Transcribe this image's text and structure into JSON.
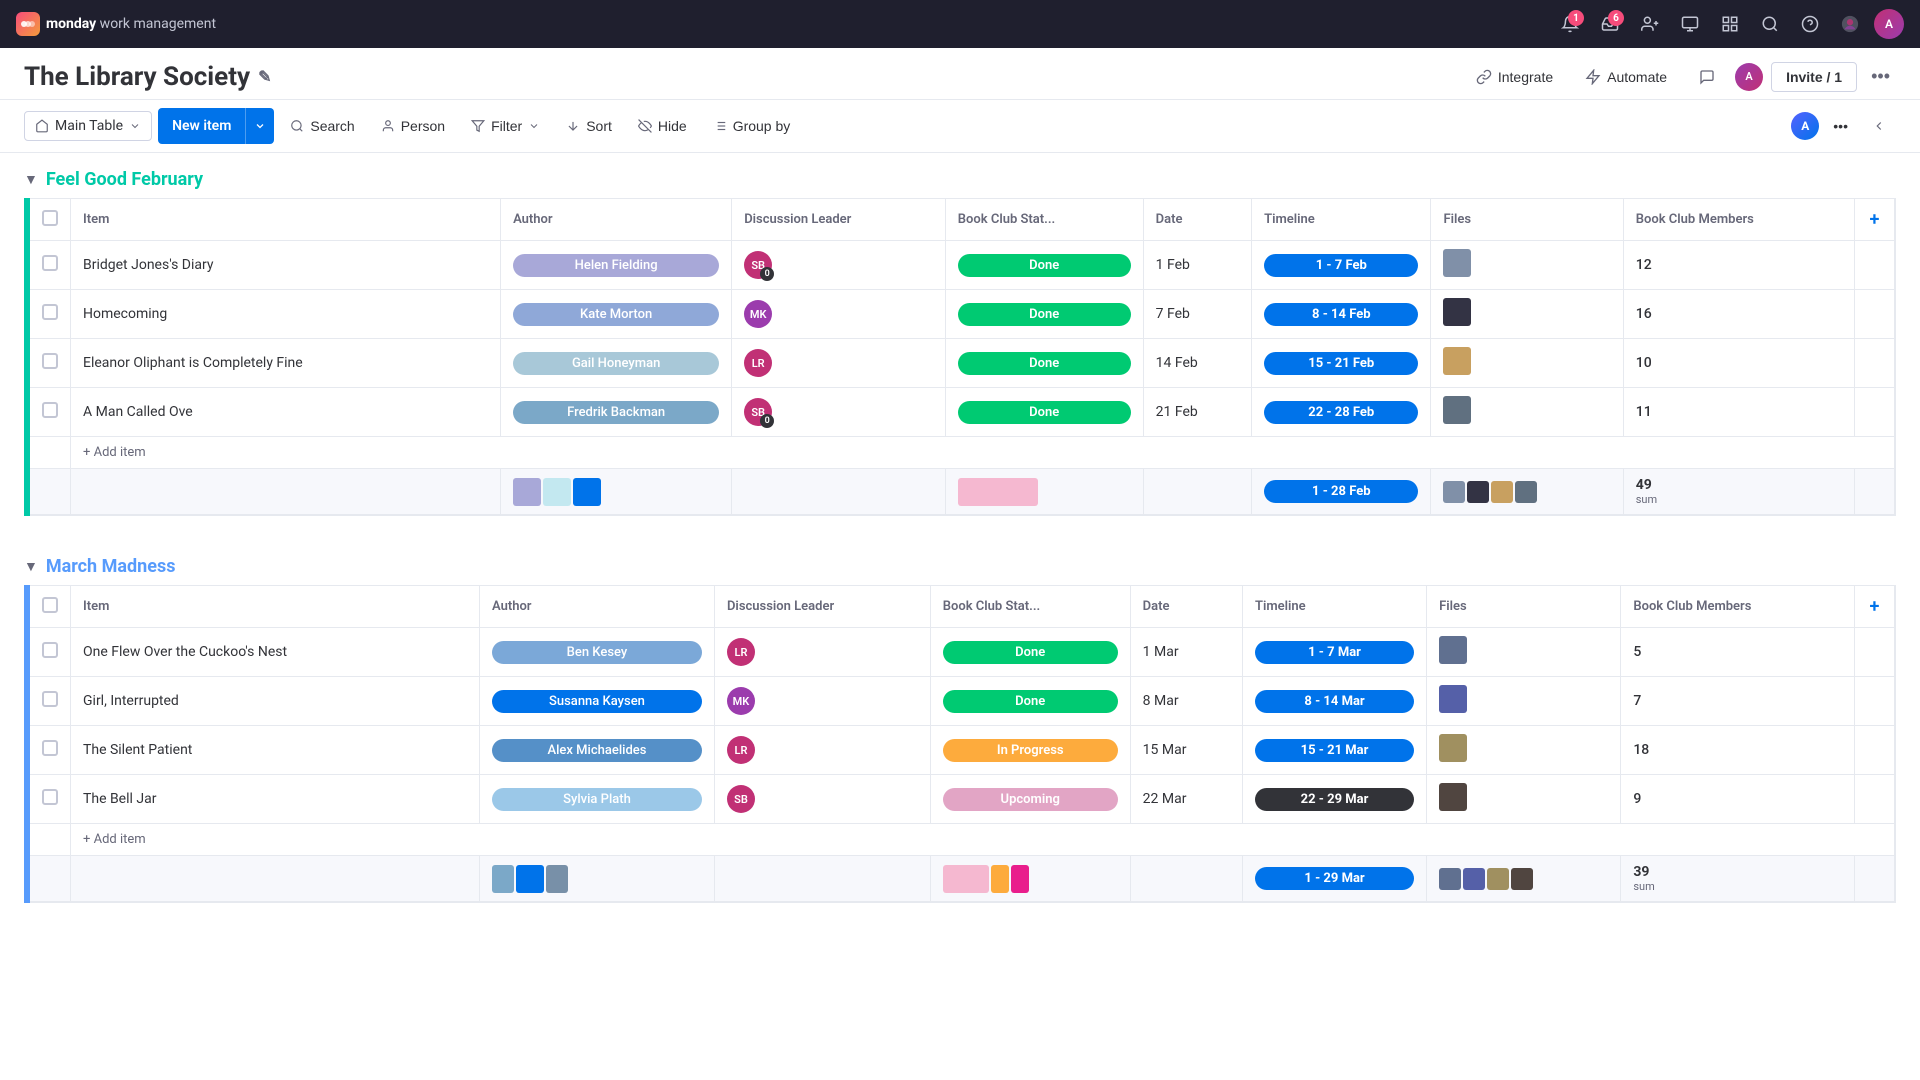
{
  "brand": {
    "logo_text": "M",
    "app_name": "monday",
    "app_sub": " work management"
  },
  "nav": {
    "notification_count": "1",
    "inbox_count": "6",
    "user_initials": "A"
  },
  "board": {
    "title": "The Library Society",
    "actions": {
      "integrate": "Integrate",
      "automate": "Automate",
      "invite_label": "Invite / 1"
    }
  },
  "toolbar": {
    "view_label": "Main Table",
    "new_item_label": "New item",
    "search_label": "Search",
    "person_label": "Person",
    "filter_label": "Filter",
    "sort_label": "Sort",
    "hide_label": "Hide",
    "group_by_label": "Group by"
  },
  "columns": {
    "item": "Item",
    "author": "Author",
    "discussion_leader": "Discussion Leader",
    "book_club_status": "Book Club Stat...",
    "date": "Date",
    "timeline": "Timeline",
    "files": "Files",
    "members": "Book Club Members"
  },
  "groups": [
    {
      "id": "feel_good_february",
      "title": "Feel Good February",
      "color": "teal",
      "rows": [
        {
          "item": "Bridget Jones's Diary",
          "author": "Helen Fielding",
          "author_color": "#a8a8d8",
          "discussion_leader_initials": "SB",
          "discussion_leader_color": "#c13075",
          "discussion_leader_badge": "0",
          "status": "Done",
          "status_type": "done",
          "date": "1 Feb",
          "timeline": "1 - 7 Feb",
          "timeline_color": "tl-blue",
          "members": "12"
        },
        {
          "item": "Homecoming",
          "author": "Kate Morton",
          "author_color": "#8fa8d8",
          "discussion_leader_initials": "MK",
          "discussion_leader_color": "#9b3cad",
          "discussion_leader_badge": "",
          "status": "Done",
          "status_type": "done",
          "date": "7 Feb",
          "timeline": "8 - 14 Feb",
          "timeline_color": "tl-blue",
          "members": "16"
        },
        {
          "item": "Eleanor Oliphant is Completely Fine",
          "author": "Gail Honeyman",
          "author_color": "#a8c8d8",
          "discussion_leader_initials": "LR",
          "discussion_leader_color": "#c13075",
          "discussion_leader_badge": "",
          "status": "Done",
          "status_type": "done",
          "date": "14 Feb",
          "timeline": "15 - 21 Feb",
          "timeline_color": "tl-blue",
          "members": "10"
        },
        {
          "item": "A Man Called Ove",
          "author": "Fredrik Backman",
          "author_color": "#7ba8c8",
          "discussion_leader_initials": "SB",
          "discussion_leader_color": "#c13075",
          "discussion_leader_badge": "0",
          "status": "Done",
          "status_type": "done",
          "date": "21 Feb",
          "timeline": "22 - 28 Feb",
          "timeline_color": "tl-blue",
          "members": "11"
        }
      ],
      "summary": {
        "total_members": "49",
        "sum_label": "sum",
        "timeline_summary": "1 - 28 Feb",
        "color_bars": [
          {
            "color": "#a8a8d8",
            "width": "25%"
          },
          {
            "color": "#c3e8f0",
            "width": "25%"
          },
          {
            "color": "#0073ea",
            "width": "25%"
          }
        ],
        "status_color_bars": [
          {
            "color": "#f5b8d0",
            "width": "100%"
          }
        ]
      },
      "add_item_label": "+ Add item"
    },
    {
      "id": "march_madness",
      "title": "March Madness",
      "color": "blue",
      "rows": [
        {
          "item": "One Flew Over the Cuckoo's Nest",
          "author": "Ben Kesey",
          "author_color": "#7ba8d8",
          "discussion_leader_initials": "LR",
          "discussion_leader_color": "#c13075",
          "discussion_leader_badge": "",
          "status": "Done",
          "status_type": "done",
          "date": "1 Mar",
          "timeline": "1 - 7 Mar",
          "timeline_color": "tl-blue",
          "members": "5"
        },
        {
          "item": "Girl, Interrupted",
          "author": "Susanna Kaysen",
          "author_color": "#0073ea",
          "discussion_leader_initials": "MK",
          "discussion_leader_color": "#9b3cad",
          "discussion_leader_badge": "",
          "status": "Done",
          "status_type": "done",
          "date": "8 Mar",
          "timeline": "8 - 14 Mar",
          "timeline_color": "tl-blue",
          "members": "7"
        },
        {
          "item": "The Silent Patient",
          "author": "Alex Michaelides",
          "author_color": "#5590c8",
          "discussion_leader_initials": "LR",
          "discussion_leader_color": "#c13075",
          "discussion_leader_badge": "",
          "status": "In Progress",
          "status_type": "inprogress",
          "date": "15 Mar",
          "timeline": "15 - 21 Mar",
          "timeline_color": "tl-blue",
          "members": "18"
        },
        {
          "item": "The Bell Jar",
          "author": "Sylvia Plath",
          "author_color": "#9bc8e8",
          "discussion_leader_initials": "SB",
          "discussion_leader_color": "#c13075",
          "discussion_leader_badge": "",
          "status": "Upcoming",
          "status_type": "upcoming",
          "date": "22 Mar",
          "timeline": "22 - 29 Mar",
          "timeline_color": "tl-dark",
          "members": "9"
        }
      ],
      "summary": {
        "total_members": "39",
        "sum_label": "sum",
        "timeline_summary": "1 - 29 Mar",
        "color_bars": [
          {
            "color": "#7ba8c8",
            "width": "20%"
          },
          {
            "color": "#0073ea",
            "width": "25%"
          },
          {
            "color": "#7890a8",
            "width": "20%"
          }
        ],
        "status_color_bars": [
          {
            "color": "#f5b8d0",
            "width": "60%"
          },
          {
            "color": "#fdab3d",
            "width": "20%"
          },
          {
            "color": "#e91e8c",
            "width": "20%"
          }
        ]
      },
      "add_item_label": "+ Add item"
    }
  ]
}
